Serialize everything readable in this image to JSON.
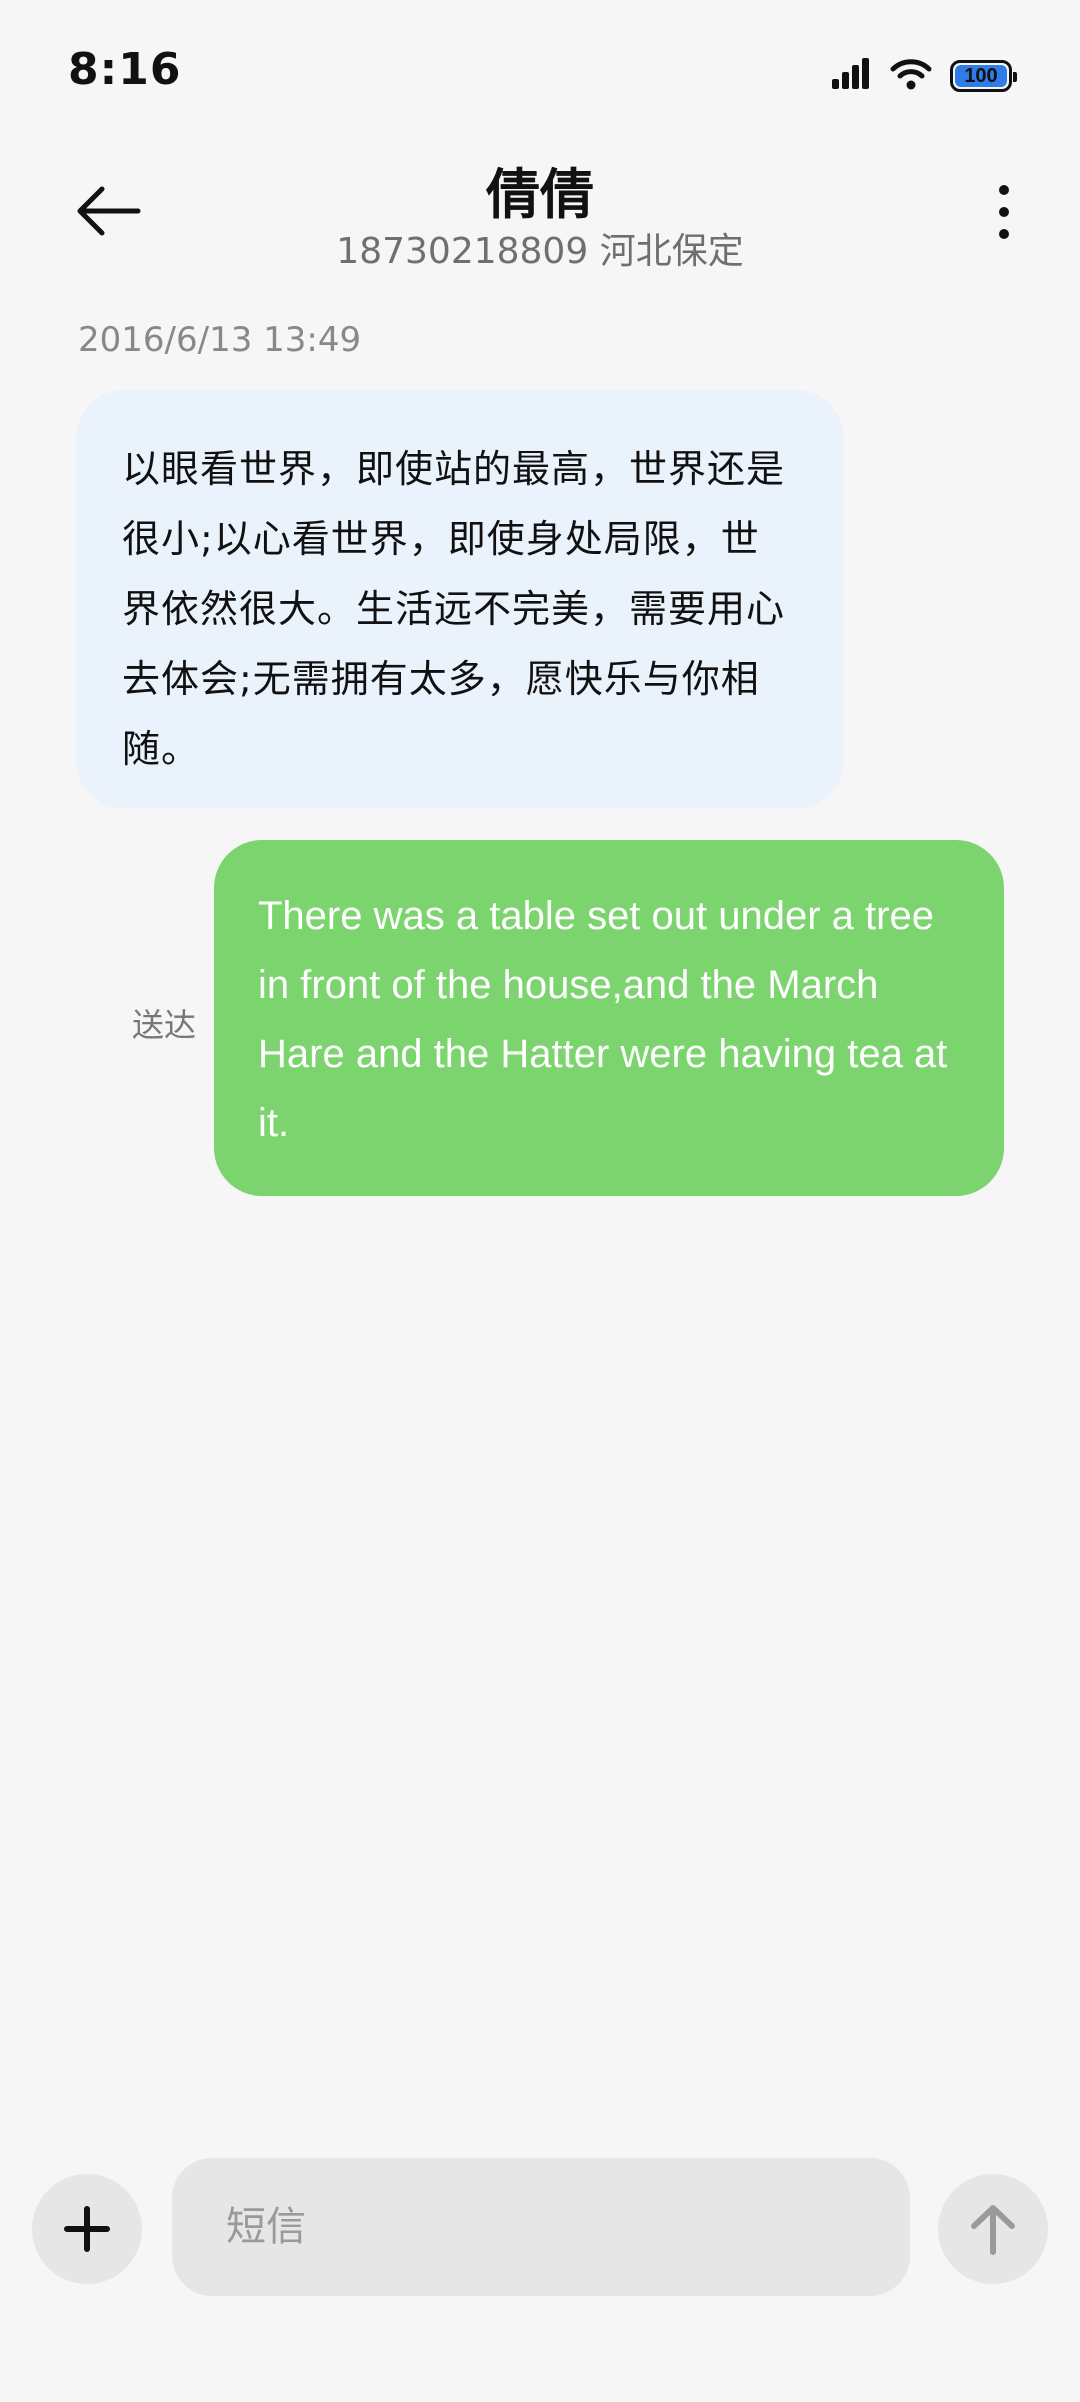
{
  "status_bar": {
    "time": "8:16",
    "battery_level": "100",
    "icons": [
      "signal-icon",
      "wifi-icon",
      "battery-icon"
    ],
    "battery_color": "#2f7be8"
  },
  "header": {
    "contact_name": "倩倩",
    "contact_subtitle": "18730218809 河北保定",
    "back_icon": "arrow-left-icon",
    "more_icon": "more-vertical-icon"
  },
  "conversation": {
    "messages": [
      {
        "direction": "incoming",
        "timestamp": "2016/6/13 13:49",
        "text": "以眼看世界，即使站的最高，世界还是很小;以心看世界，即使身处局限，世界依然很大。生活远不完美，需要用心去体会;无需拥有太多，愿快乐与你相随。",
        "bubble_color": "#eaf2fc"
      },
      {
        "direction": "outgoing",
        "status": "送达",
        "text": "There was a table set out under a tree in front of the house,and the March Hare and the Hatter were having tea at it.",
        "bubble_color": "#7bd46d"
      }
    ]
  },
  "composer": {
    "placeholder": "短信",
    "value": "",
    "add_icon": "plus-icon",
    "send_icon": "arrow-up-icon"
  }
}
